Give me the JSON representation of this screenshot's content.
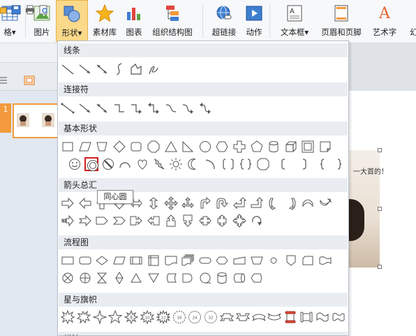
{
  "ribbon": {
    "table_label": "格▾",
    "picture_label": "图片",
    "shape_label": "形状▾",
    "material_label": "素材库",
    "chart_label": "图表",
    "org_label": "组织结构图",
    "hyperlink_label": "超链接",
    "action_label": "动作",
    "textbox_label": "文本框▾",
    "header_footer_label": "页眉和页脚",
    "art_label": "艺术字",
    "art_letter": "A",
    "cut_label": "幻"
  },
  "slides": {
    "slide_number": "1"
  },
  "slide_photo_text": "一大首的！",
  "shapes_menu": {
    "sections": {
      "lines": "线条",
      "connectors": "连接符",
      "basic": "基本形状",
      "arrows": "箭头总汇",
      "flowchart": "流程图",
      "stars": "星与旗帜",
      "callouts": "标注"
    }
  },
  "tooltip": "同心圆",
  "colors": {
    "active_tab": "#fbd98a",
    "selection_border": "#d21f1f",
    "section_header_bg": "#e9edf2",
    "slide_accent": "#f39a3c"
  }
}
